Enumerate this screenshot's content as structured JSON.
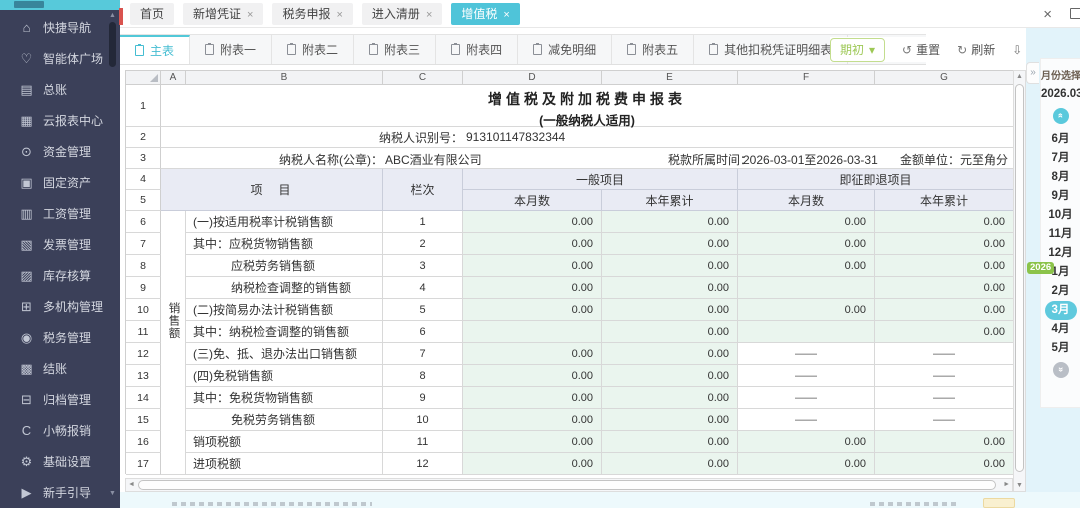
{
  "colors": {
    "accent_teal": "#52c8d8",
    "sidebar_bg": "#3b4059",
    "active_tab_bg": "#4fc4d9",
    "mint_cell": "#eaf5ee",
    "header_row_bg": "#e9ebf4",
    "badge_green": "#8bc34a",
    "period_button_green": "#9dc855",
    "rail_blue": "#e2f3fa"
  },
  "icons": {
    "close": "×",
    "collapse": "»",
    "dropdown": "▾",
    "reset": "↺",
    "refresh": "↻",
    "download": "⇩",
    "scroll_up": "▲",
    "scroll_down": "▼",
    "scroll_left": "◄",
    "scroll_right": "►",
    "chevron_double": "«"
  },
  "sidebar": {
    "items": [
      {
        "icon": "home-icon",
        "glyph": "⌂",
        "label": "快捷导航"
      },
      {
        "icon": "heart-icon",
        "glyph": "♡",
        "label": "智能体广场"
      },
      {
        "icon": "ledger-icon",
        "glyph": "▤",
        "label": "总账"
      },
      {
        "icon": "cloud-report-icon",
        "glyph": "▦",
        "label": "云报表中心"
      },
      {
        "icon": "money-bag-icon",
        "glyph": "⊙",
        "label": "资金管理"
      },
      {
        "icon": "fixed-asset-icon",
        "glyph": "▣",
        "label": "固定资产"
      },
      {
        "icon": "payroll-icon",
        "glyph": "▥",
        "label": "工资管理"
      },
      {
        "icon": "invoice-icon",
        "glyph": "▧",
        "label": "发票管理"
      },
      {
        "icon": "inventory-icon",
        "glyph": "▨",
        "label": "库存核算"
      },
      {
        "icon": "org-chart-icon",
        "glyph": "⊞",
        "label": "多机构管理"
      },
      {
        "icon": "tax-icon",
        "glyph": "◉",
        "label": "税务管理"
      },
      {
        "icon": "closing-icon",
        "glyph": "▩",
        "label": "结账"
      },
      {
        "icon": "archive-icon",
        "glyph": "⊟",
        "label": "归档管理"
      },
      {
        "icon": "c-logo-icon",
        "glyph": "C",
        "label": "小畅报销"
      },
      {
        "icon": "gear-icon",
        "glyph": "⚙",
        "label": "基础设置"
      },
      {
        "icon": "guide-icon",
        "glyph": "▶",
        "label": "新手引导"
      }
    ]
  },
  "topbar": {
    "close_label": "×",
    "tabs": [
      {
        "label": "首页",
        "closable": false,
        "active": false
      },
      {
        "label": "新增凭证",
        "closable": true,
        "active": false
      },
      {
        "label": "税务申报",
        "closable": true,
        "active": false
      },
      {
        "label": "进入清册",
        "closable": true,
        "active": false
      },
      {
        "label": "增值税",
        "closable": true,
        "active": true
      }
    ]
  },
  "sheetbar": {
    "tabs": [
      {
        "label": "主表",
        "active": true
      },
      {
        "label": "附表一",
        "active": false
      },
      {
        "label": "附表二",
        "active": false
      },
      {
        "label": "附表三",
        "active": false
      },
      {
        "label": "附表四",
        "active": false
      },
      {
        "label": "减免明细",
        "active": false
      },
      {
        "label": "附表五",
        "active": false
      },
      {
        "label": "其他扣税凭证明细表",
        "active": false
      }
    ]
  },
  "toolbar": {
    "period": "期初",
    "reset": "重置",
    "refresh": "刷新",
    "download": "下载"
  },
  "spreadsheet": {
    "col_letters": [
      "A",
      "B",
      "C",
      "D",
      "E",
      "F",
      "G"
    ],
    "row_numbers": [
      "1",
      "2",
      "3",
      "4",
      "5",
      "6",
      "7",
      "8",
      "9",
      "10",
      "11",
      "12",
      "13",
      "14",
      "15",
      "16",
      "17"
    ],
    "title1": "增值税及附加税费申报表",
    "title2": "(一般纳税人适用)",
    "taxpayer_id_label": "纳税人识别号：",
    "taxpayer_id": "913101147832344",
    "name_label": "纳税人名称(公章)：",
    "name_value": "ABC酒业有限公司",
    "period_label": "税款所属时间：",
    "period_value": "2026-03-01至2026-03-31",
    "unit_label": "金额单位：元至角分",
    "header": {
      "item": "项　目",
      "col": "栏次",
      "general": "一般项目",
      "refund": "即征即退项目",
      "month": "本月数",
      "ytd": "本年累计"
    },
    "row_group_label": "销售额",
    "rows": [
      {
        "item": "(一)按适用税率计税销售额",
        "indent": 0,
        "col": "1",
        "d": "0.00",
        "e": "0.00",
        "f": "0.00",
        "g": "0.00"
      },
      {
        "item": "其中：应税货物销售额",
        "indent": 0,
        "col": "2",
        "d": "0.00",
        "e": "0.00",
        "f": "0.00",
        "g": "0.00"
      },
      {
        "item": "应税劳务销售额",
        "indent": 1,
        "col": "3",
        "d": "0.00",
        "e": "0.00",
        "f": "0.00",
        "g": "0.00"
      },
      {
        "item": "纳税检查调整的销售额",
        "indent": 1,
        "col": "4",
        "d": "0.00",
        "e": "0.00",
        "f": "",
        "g": "0.00"
      },
      {
        "item": "(二)按简易办法计税销售额",
        "indent": 0,
        "col": "5",
        "d": "0.00",
        "e": "0.00",
        "f": "0.00",
        "g": "0.00"
      },
      {
        "item": "其中：纳税检查调整的销售额",
        "indent": 0,
        "col": "6",
        "d": "",
        "e": "0.00",
        "f": "",
        "g": "0.00"
      },
      {
        "item": "(三)免、抵、退办法出口销售额",
        "indent": 0,
        "col": "7",
        "d": "0.00",
        "e": "0.00",
        "f": "——",
        "g": "——"
      },
      {
        "item": "(四)免税销售额",
        "indent": 0,
        "col": "8",
        "d": "0.00",
        "e": "0.00",
        "f": "——",
        "g": "——"
      },
      {
        "item": "其中：免税货物销售额",
        "indent": 0,
        "col": "9",
        "d": "0.00",
        "e": "0.00",
        "f": "——",
        "g": "——"
      },
      {
        "item": "免税劳务销售额",
        "indent": 1,
        "col": "10",
        "d": "0.00",
        "e": "0.00",
        "f": "——",
        "g": "——"
      },
      {
        "item": "销项税额",
        "indent": 0,
        "col": "11",
        "d": "0.00",
        "e": "0.00",
        "f": "0.00",
        "g": "0.00"
      },
      {
        "item": "进项税额",
        "indent": 0,
        "col": "12",
        "d": "0.00",
        "e": "0.00",
        "f": "0.00",
        "g": "0.00"
      }
    ]
  },
  "month_panel": {
    "title": "月份选择",
    "period": "2026.03",
    "year_badge": "2026",
    "months": [
      "6月",
      "7月",
      "8月",
      "9月",
      "10月",
      "11月",
      "12月",
      "1月",
      "2月",
      "3月",
      "4月",
      "5月"
    ],
    "selected": "3月"
  }
}
